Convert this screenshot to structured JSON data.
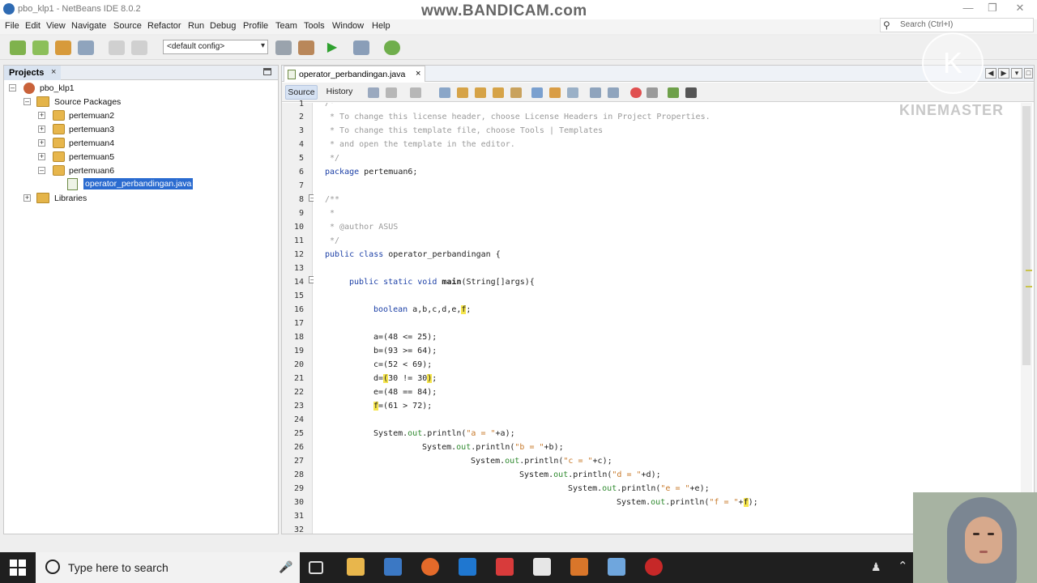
{
  "window": {
    "title": "pbo_klp1 - NetBeans IDE 8.0.2",
    "watermark": "www.BANDICAM.com"
  },
  "menu": [
    "File",
    "Edit",
    "View",
    "Navigate",
    "Source",
    "Refactor",
    "Run",
    "Debug",
    "Profile",
    "Team",
    "Tools",
    "Window",
    "Help"
  ],
  "search": {
    "placeholder": "Search (Ctrl+I)"
  },
  "toolbar": {
    "config": "<default config>"
  },
  "projects": {
    "title": "Projects",
    "tree": {
      "project": "pbo_klp1",
      "source_packages": "Source Packages",
      "packages": [
        "pertemuan2",
        "pertemuan3",
        "pertemuan4",
        "pertemuan5",
        "pertemuan6"
      ],
      "selected_file": "operator_perbandingan.java",
      "libraries": "Libraries"
    }
  },
  "editor": {
    "tab": "operator_perbandingan.java",
    "views": {
      "source": "Source",
      "history": "History"
    },
    "line_numbers": [
      "1",
      "2",
      "3",
      "4",
      "5",
      "6",
      "7",
      "8",
      "9",
      "10",
      "11",
      "12",
      "13",
      "14",
      "15",
      "16",
      "17",
      "18",
      "19",
      "20",
      "21",
      "22",
      "23",
      "24",
      "25",
      "26",
      "27",
      "28",
      "29",
      "30",
      "31",
      "32"
    ],
    "code": {
      "l1": "/*",
      "l2": " * To change this license header, choose License Headers in Project Properties.",
      "l3": " * To change this template file, choose Tools | Templates",
      "l4": " * and open the template in the editor.",
      "l5": " */",
      "l6_kw": "package",
      "l6_rest": " pertemuan6;",
      "l8": "/**",
      "l9": " *",
      "l10": " * @author ASUS",
      "l11": " */",
      "l12_kw": "public class",
      "l12_rest": " operator_perbandingan {",
      "l14_kw": "public static void",
      "l14_name": " main",
      "l14_rest": "(String[]args){",
      "l16_kw": "boolean",
      "l16_rest": " a,b,c,d,e,",
      "l16_f": "f",
      "l16_end": ";",
      "l18": "a=(48 <= 25);",
      "l19": "b=(93 >= 64);",
      "l20": "c=(52 < 69);",
      "l21_a": "d=",
      "l21_p1": "(",
      "l21_b": "30 != 30",
      "l21_p2": ")",
      "l21_end": ";",
      "l22": "e=(48 == 84);",
      "l23_f": "f",
      "l23_rest": "=(61 > 72);",
      "l25_a": "System.",
      "l25_out": "out",
      "l25_b": ".println(",
      "l25_str": "\"a = \"",
      "l25_c": "+a);",
      "l26_str": "\"b = \"",
      "l26_c": "+b);",
      "l27_str": "\"c = \"",
      "l27_c": "+c);",
      "l28_str": "\"d = \"",
      "l28_c": "+d);",
      "l29_str": "\"e = \"",
      "l29_c": "+e);",
      "l30_str": "\"f = \"",
      "l30_plus": "+",
      "l30_f": "f",
      "l30_c": ");"
    }
  },
  "overlay": {
    "kinemaster": "KINEMASTER",
    "k_logo": "K"
  },
  "taskbar": {
    "search_placeholder": "Type here to search"
  },
  "colors": {
    "keyword": "#1b3fa6",
    "comment": "#9a9a9a",
    "string": "#c7792a",
    "field": "#2f8a2f",
    "highlight": "#f6e54c",
    "selection": "#2a6bd0"
  }
}
